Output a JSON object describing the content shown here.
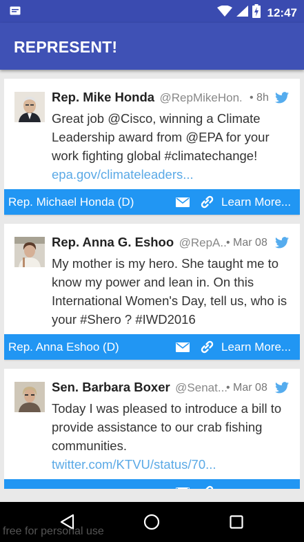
{
  "status_bar": {
    "time": "12:47",
    "icons": [
      "notification-icon",
      "wifi-icon",
      "signal-icon",
      "battery-icon"
    ]
  },
  "app_bar": {
    "title": "REPRESENT!"
  },
  "cards": [
    {
      "name": "Rep. Mike Honda",
      "handle": "@RepMikeHon...",
      "time": "• 8h",
      "tweet_text": "Great job @Cisco, winning a Climate Leadership award from @EPA for your work fighting global #climatechange!",
      "tweet_link": "epa.gov/climateleaders...",
      "footer_rep": "Rep. Michael Honda (D)",
      "learn_more": "Learn More..."
    },
    {
      "name": "Rep. Anna G. Eshoo",
      "handle": "@RepA...",
      "time": "• Mar 08",
      "tweet_text": "My mother is my hero. She taught me to know my power and lean in. On this International Women's Day, tell us, who is your #Shero ? #IWD2016",
      "tweet_link": "",
      "footer_rep": "Rep. Anna Eshoo (D)",
      "learn_more": "Learn More..."
    },
    {
      "name": "Sen. Barbara Boxer",
      "handle": "@Senat...",
      "time": "• Mar 08",
      "tweet_text": "Today I was pleased to introduce a bill to provide assistance to our crab fishing communities.",
      "tweet_link": "twitter.com/KTVU/status/70...",
      "footer_rep": "",
      "learn_more": ""
    }
  ],
  "watermark": "free for personal use",
  "colors": {
    "status_bar": "#3a4bb0",
    "app_bar": "#3f51b5",
    "card_footer": "#2196f3",
    "link": "#5aa9e6",
    "twitter_bird": "#55acee"
  }
}
